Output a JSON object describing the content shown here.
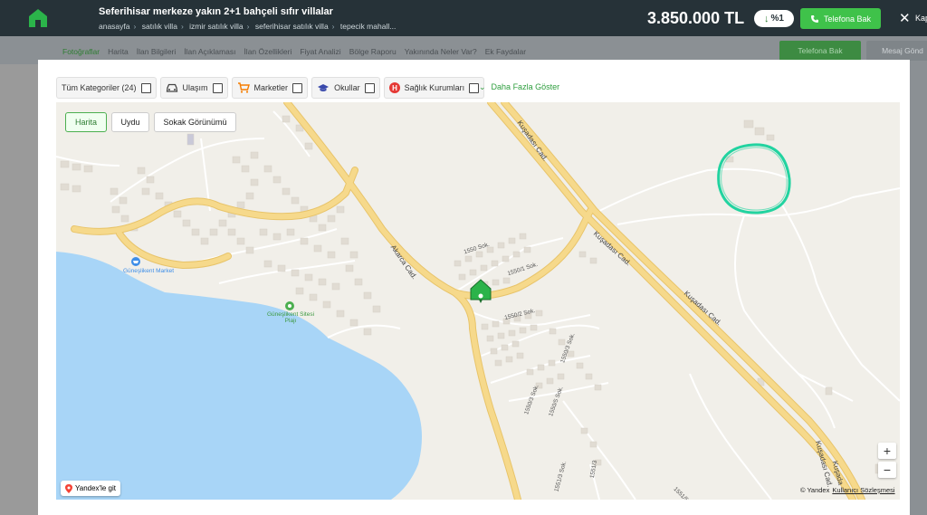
{
  "header": {
    "title": "Seferihisar merkeze yakın 2+1 bahçeli sıfır villalar",
    "breadcrumbs": [
      "anasayfa",
      "satılık villa",
      "izmir satılık villa",
      "seferihisar satılık villa",
      "tepecik mahall..."
    ],
    "price": "3.850.000 TL",
    "discount": "%1",
    "call_button": "Telefona Bak",
    "close_label": "Kap"
  },
  "tabs": {
    "items": [
      "Fotoğraflar",
      "Harita",
      "İlan Bilgileri",
      "İlan Açıklaması",
      "İlan Özellikleri",
      "Fiyat Analizi",
      "Bölge Raporu",
      "Yakınında Neler Var?",
      "Ek Faydalar"
    ],
    "active": "Fotoğraflar",
    "call_button": "Telefona Bak",
    "message_button": "Mesaj Gönd"
  },
  "filters": {
    "items": [
      {
        "label": "Tüm Kategoriler (24)",
        "icon": "none"
      },
      {
        "label": "Ulaşım",
        "icon": "car-icon"
      },
      {
        "label": "Marketler",
        "icon": "cart-icon"
      },
      {
        "label": "Okullar",
        "icon": "graduation-cap-icon"
      },
      {
        "label": "Sağlık Kurumları",
        "icon": "hospital-icon"
      }
    ],
    "more_label": "Daha Fazla Göster"
  },
  "map": {
    "types": [
      "Harita",
      "Uydu",
      "Sokak Görünümü"
    ],
    "active_type": "Harita",
    "roads": [
      "Kuşadası Cad.",
      "Kuşadası Cad.",
      "Kuşadası Cad.",
      "Akarca Cad.",
      "1550/1 Sok.",
      "1550 Sok.",
      "1550/2 Sok.",
      "1550/3 Sok.",
      "1550/3 Sok.",
      "1550/5 Sok.",
      "1551/3 Sok.",
      "1551/3",
      "1551/5",
      "Kuşadası Cad.",
      "Kuşada"
    ],
    "pois": [
      {
        "name": "Güneşlikent Market",
        "type": "market"
      },
      {
        "name": "Güneşlikent Sitesi Plajı",
        "type": "beach"
      }
    ],
    "zoom_in": "+",
    "zoom_out": "−",
    "yandex_link": "Yandex'le git",
    "copyright": "© Yandex",
    "terms": "Kullanıcı Sözleşmesi",
    "colors": {
      "road": "#f6d98b",
      "water": "#a8d5f7",
      "land": "#f1efe9",
      "building": "#e1dcd3",
      "area_circle": "#22d3a0",
      "marker": "#2bb34a"
    }
  },
  "colors": {
    "header_bg": "#263238",
    "accent_green": "#3fc24a"
  }
}
